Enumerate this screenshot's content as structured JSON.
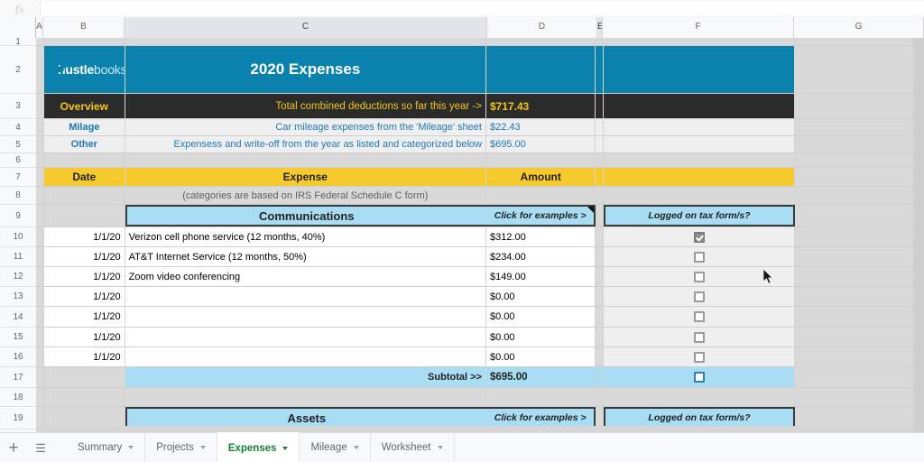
{
  "app": {
    "formula_bar_icon": "fx-icon",
    "formula_value": ""
  },
  "grid": {
    "column_headers": [
      "A",
      "B",
      "C",
      "D",
      "E",
      "F",
      "G"
    ],
    "selected_columns": [
      "C",
      "E"
    ],
    "row_numbers": [
      "1",
      "2",
      "3",
      "4",
      "5",
      "6",
      "7",
      "8",
      "9",
      "10",
      "11",
      "12",
      "13",
      "14",
      "15",
      "16",
      "17",
      "18",
      "19"
    ]
  },
  "banner": {
    "logo_bold": "hustle",
    "logo_light": "books",
    "title": "2020 Expenses",
    "bg_color": "#0b81ad"
  },
  "overview": {
    "label": "Overview",
    "total_text": "Total combined deductions so far this year ->",
    "total_value": "$717.43",
    "bg_color": "#2b2b2b",
    "text_color": "#f5c518"
  },
  "summary_rows": [
    {
      "label": "Milage",
      "description": "Car mileage expenses from the 'Mileage' sheet",
      "amount": "$22.43"
    },
    {
      "label": "Other",
      "description": "Expensess and write-off from the year as listed and categorized below",
      "amount": "$695.00"
    }
  ],
  "table_header": {
    "date": "Date",
    "expense": "Expense",
    "amount": "Amount",
    "bg_color": "#f7cb2e"
  },
  "note_row": {
    "text": "(categories are based on IRS Federal Schedule C form)"
  },
  "categories": [
    {
      "name": "Communications",
      "examples_label": "Click for examples >",
      "logged_label": "Logged on tax form/s?",
      "has_note": true
    },
    {
      "name": "Assets",
      "examples_label": "Click for examples >",
      "logged_label": "Logged on tax form/s?",
      "has_note": false
    }
  ],
  "expense_rows": [
    {
      "date": "1/1/20",
      "expense": "Verizon cell phone service (12 months, 40%)",
      "amount": "$312.00",
      "logged": true
    },
    {
      "date": "1/1/20",
      "expense": "AT&T Internet Service (12 months, 50%)",
      "amount": "$234.00",
      "logged": false
    },
    {
      "date": "1/1/20",
      "expense": "Zoom video conferencing",
      "amount": "$149.00",
      "logged": false
    },
    {
      "date": "1/1/20",
      "expense": "",
      "amount": "$0.00",
      "logged": false
    },
    {
      "date": "1/1/20",
      "expense": "",
      "amount": "$0.00",
      "logged": false
    },
    {
      "date": "1/1/20",
      "expense": "",
      "amount": "$0.00",
      "logged": false
    },
    {
      "date": "1/1/20",
      "expense": "",
      "amount": "$0.00",
      "logged": false
    }
  ],
  "subtotal": {
    "label": "Subtotal >>",
    "value": "$695.00",
    "bg_color": "#a9ddf3"
  },
  "sheet_bar": {
    "add_icon": "plus-icon",
    "list_icon": "all-sheets-icon",
    "tabs": [
      {
        "label": "Summary",
        "active": false
      },
      {
        "label": "Projects",
        "active": false
      },
      {
        "label": "Expenses",
        "active": true
      },
      {
        "label": "Mileage",
        "active": false
      },
      {
        "label": "Worksheet",
        "active": false
      }
    ],
    "active_color": "#188038"
  }
}
